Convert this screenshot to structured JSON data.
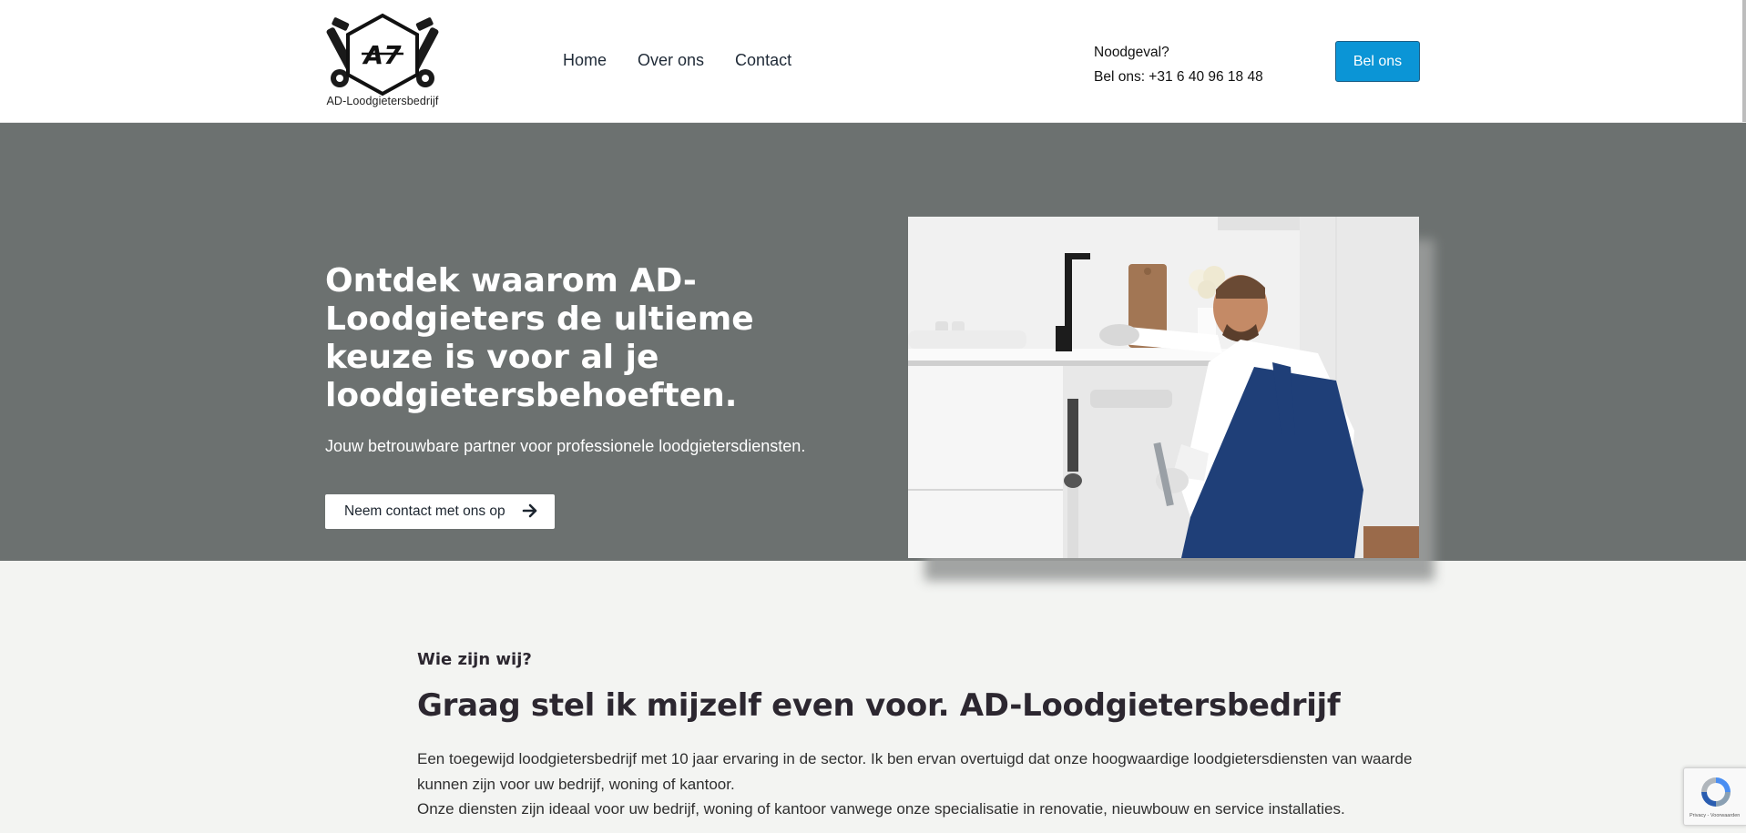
{
  "header": {
    "logo_text": "AD-Loodgietersbedrijf",
    "nav": [
      "Home",
      "Over ons",
      "Contact"
    ],
    "emergency_line1": "Noodgeval?",
    "emergency_line2": "Bel ons: +31 6 40 96 18 48",
    "call_button": "Bel ons"
  },
  "hero": {
    "title": "Ontdek waarom AD-Loodgieters de ultieme keuze is voor al je loodgietersbehoeften.",
    "subtitle": "Jouw betrouwbare partner voor professionele loodgietersdiensten.",
    "cta": "Neem contact met ons op"
  },
  "about": {
    "kicker": "Wie zijn wij?",
    "title": "Graag stel ik mijzelf even voor. AD-Loodgietersbedrijf",
    "paragraph1": "Een toegewijd loodgietersbedrijf met 10 jaar ervaring in de sector. Ik ben ervan overtuigd dat onze hoogwaardige loodgietersdiensten van waarde kunnen zijn voor uw bedrijf, woning of kantoor.",
    "paragraph2": "Onze diensten zijn ideaal voor uw bedrijf, woning of kantoor vanwege onze specialisatie in renovatie, nieuwbouw en service installaties."
  },
  "recaptcha": {
    "text": "Privacy - Voorwaarden"
  },
  "colors": {
    "hero_bg": "#6c7170",
    "call_button": "#0b95d6",
    "section_bg": "#f3f4f2"
  },
  "icons": [
    "hex-wrench-logo-icon",
    "arrow-right-icon",
    "recaptcha-icon"
  ]
}
